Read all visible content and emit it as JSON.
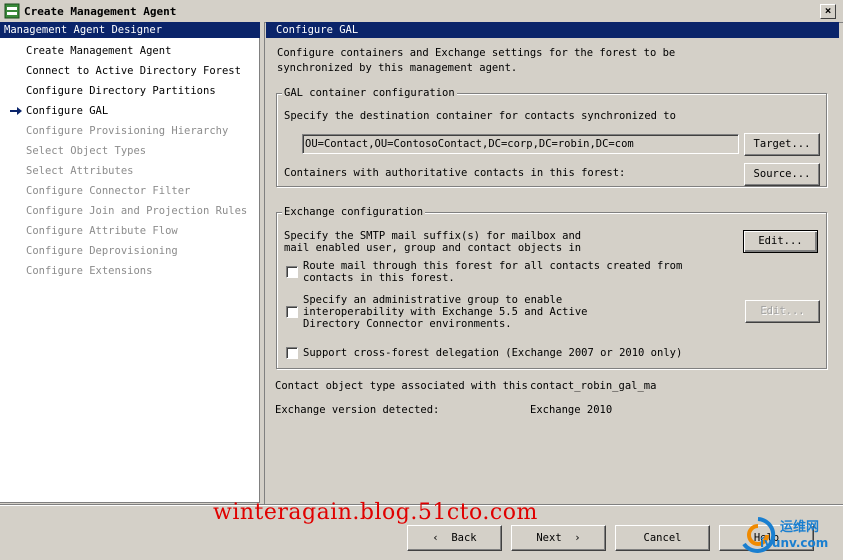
{
  "window": {
    "title": "Create Management Agent",
    "close_label": "×"
  },
  "left": {
    "header": "Management Agent Designer",
    "items": [
      {
        "label": "Create Management Agent",
        "enabled": true
      },
      {
        "label": "Connect to Active Directory Forest",
        "enabled": true
      },
      {
        "label": "Configure Directory Partitions",
        "enabled": true
      },
      {
        "label": "Configure GAL",
        "enabled": true,
        "current": true
      },
      {
        "label": "Configure Provisioning Hierarchy",
        "enabled": false
      },
      {
        "label": "Select Object Types",
        "enabled": false
      },
      {
        "label": "Select Attributes",
        "enabled": false
      },
      {
        "label": "Configure Connector Filter",
        "enabled": false
      },
      {
        "label": "Configure Join and Projection Rules",
        "enabled": false
      },
      {
        "label": "Configure Attribute Flow",
        "enabled": false
      },
      {
        "label": "Configure Deprovisioning",
        "enabled": false
      },
      {
        "label": "Configure Extensions",
        "enabled": false
      }
    ]
  },
  "right": {
    "header": "Configure GAL",
    "intro_line1": "Configure containers and Exchange settings for the forest to be",
    "intro_line2": "synchronized by this management agent.",
    "gal": {
      "title": "GAL container configuration",
      "dest_label": "Specify the destination container for contacts synchronized to",
      "dest_value": "OU=Contact,OU=ContosoContact,DC=corp,DC=robin,DC=com",
      "target_button": "Target...",
      "auth_label": "Containers with authoritative contacts in this forest:",
      "source_button": "Source..."
    },
    "exchange": {
      "title": "Exchange configuration",
      "smtp_line1": "Specify the SMTP mail suffix(s) for mailbox and",
      "smtp_line2": "mail enabled user, group and contact objects in",
      "edit_button": "Edit...",
      "route_line1": "Route mail through this forest for all contacts created from",
      "route_line2": "contacts in this forest.",
      "admin_line1": "Specify an administrative group to enable",
      "admin_line2": "interoperability with Exchange 5.5 and Active",
      "admin_line3": "Directory Connector environments.",
      "edit2_button": "Edit...",
      "delegation_label": "Support cross-forest delegation (Exchange 2007 or 2010 only)"
    },
    "contact_type_label": "Contact object type associated with this",
    "contact_type_value": "contact_robin_gal_ma",
    "exchange_version_label": "Exchange version detected:",
    "exchange_version_value": "Exchange 2010"
  },
  "footer": {
    "back": "Back",
    "next": "Next",
    "cancel": "Cancel",
    "help": "Help"
  },
  "watermark": "winteragain.blog.51cto.com",
  "logo": {
    "line1": "运维网",
    "line2": "iyunv.com"
  },
  "colors": {
    "title_blue": "#0a246a",
    "face": "#d4d0c8",
    "watermark": "#e00000"
  }
}
